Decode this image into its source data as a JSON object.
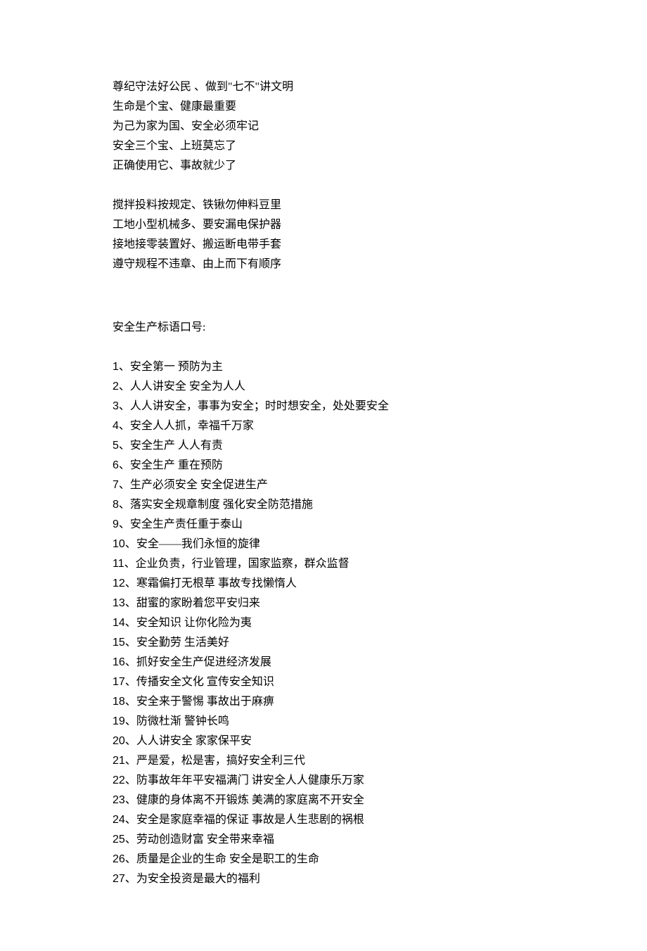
{
  "block1": [
    "尊纪守法好公民 、做到\"七不\"讲文明",
    "生命是个宝、健康最重要",
    "为己为家为国、安全必须牢记",
    "安全三个宝、上班莫忘了",
    "正确使用它、事故就少了"
  ],
  "block2": [
    "搅拌投料按规定、铁锹勿伸料豆里",
    "工地小型机械多、要安漏电保护器",
    "接地接零装置好、搬运断电带手套",
    "遵守规程不违章、由上而下有顺序"
  ],
  "section_title": "安全生产标语口号:",
  "slogans": [
    "安全第一 预防为主",
    "人人讲安全 安全为人人",
    "人人讲安全，事事为安全；时时想安全，处处要安全",
    "安全人人抓，幸福千万家",
    "安全生产 人人有责",
    "安全生产 重在预防",
    "生产必须安全 安全促进生产",
    "落实安全规章制度 强化安全防范措施",
    "安全生产责任重于泰山",
    "安全——我们永恒的旋律",
    "企业负责，行业管理，国家监察，群众监督",
    "寒霜偏打无根草 事故专找懒惰人",
    "甜蜜的家盼着您平安归来",
    "安全知识 让你化险为夷",
    "安全勤劳 生活美好",
    "抓好安全生产促进经济发展",
    "传播安全文化 宣传安全知识",
    "安全来于警惕 事故出于麻痹",
    "防微杜渐 警钟长鸣",
    "人人讲安全 家家保平安",
    "严是爱，松是害，搞好安全利三代",
    "防事故年年平安福满门 讲安全人人健康乐万家",
    "健康的身体离不开锻炼 美满的家庭离不开安全",
    "安全是家庭幸福的保证 事故是人生悲剧的祸根",
    "劳动创造财富 安全带来幸福",
    "质量是企业的生命 安全是职工的生命",
    "为安全投资是最大的福利"
  ]
}
